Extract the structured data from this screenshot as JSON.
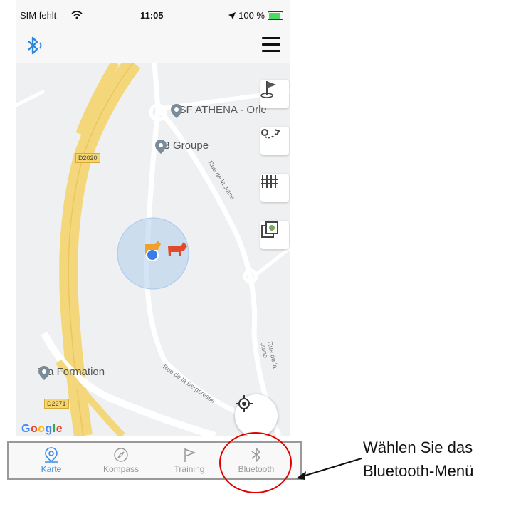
{
  "status_bar": {
    "carrier": "SIM fehlt",
    "time": "11:05",
    "battery": "100 %"
  },
  "map": {
    "pois": [
      {
        "label": "GSF ATHENA - Orle"
      },
      {
        "label": "DB Groupe"
      },
      {
        "label": "Via Formation"
      }
    ],
    "road_labels": [
      "Rue de la Juine",
      "Rue de la Juine",
      "Rue de la Bergeresse"
    ],
    "route_badges": [
      "D2020",
      "D2271"
    ],
    "attribution": "Google"
  },
  "tabs": [
    {
      "label": "Karte",
      "icon": "map-pin-icon",
      "active": true
    },
    {
      "label": "Kompass",
      "icon": "compass-icon",
      "active": false
    },
    {
      "label": "Training",
      "icon": "flag-icon",
      "active": false
    },
    {
      "label": "Bluetooth",
      "icon": "bluetooth-icon",
      "active": false
    }
  ],
  "annotation": {
    "line1": "Wählen Sie das",
    "line2": "Bluetooth-Menü"
  },
  "colors": {
    "accent": "#3b8fe3",
    "highlight": "#e00000",
    "route": "#f6d66a"
  }
}
